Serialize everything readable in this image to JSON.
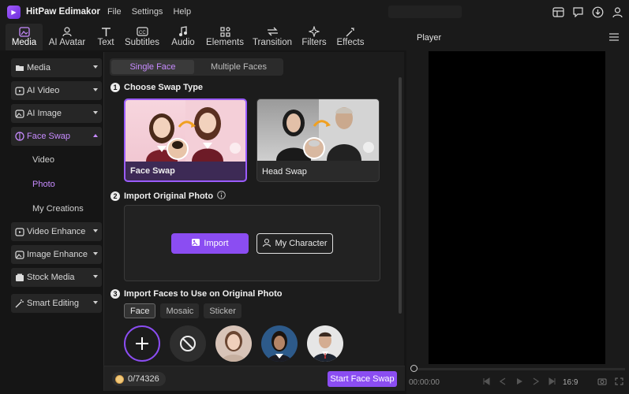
{
  "app": {
    "name": "HitPaw Edimakor",
    "menus": [
      "File",
      "Settings",
      "Help"
    ]
  },
  "toolbar": {
    "items": [
      "Media",
      "AI Avatar",
      "Text",
      "Subtitles",
      "Audio",
      "Elements",
      "Transition",
      "Filters",
      "Effects"
    ],
    "active": "Media"
  },
  "sidebar": {
    "items": [
      "Media",
      "AI Video",
      "AI Image",
      "Face Swap",
      "Video Enhance",
      "Image Enhance",
      "Stock Media",
      "Smart Editing"
    ],
    "faceswap_sub": [
      "Video",
      "Photo",
      "My Creations"
    ],
    "selected_sub": "Photo"
  },
  "segment": {
    "single": "Single Face",
    "multiple": "Multiple Faces"
  },
  "steps": {
    "s1": "Choose Swap Type",
    "s2": "Import Original Photo",
    "s3": "Import Faces to Use on Original Photo"
  },
  "cards": {
    "face_swap": "Face Swap",
    "head_swap": "Head Swap"
  },
  "buttons": {
    "import": "Import",
    "my_character": "My Character",
    "start": "Start Face Swap"
  },
  "face_tabs": [
    "Face",
    "Mosaic",
    "Sticker"
  ],
  "credits": {
    "used": "0",
    "total": "/74326"
  },
  "player": {
    "title": "Player",
    "time": "00:00:00",
    "ratio": "16:9"
  },
  "colors": {
    "accent": "#8b4df2",
    "accent_text": "#c78bff"
  }
}
